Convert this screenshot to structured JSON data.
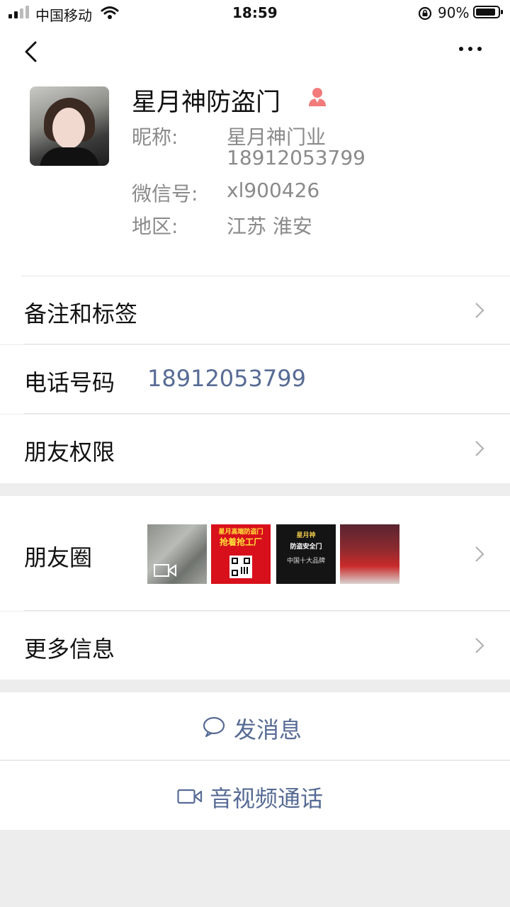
{
  "status_bar": {
    "carrier": "中国移动",
    "time": "18:59",
    "battery": "90%",
    "battery_level": 0.9
  },
  "profile": {
    "name": "星月神防盗门",
    "nickname_label": "昵称:",
    "nickname_line1": "星月神门业",
    "nickname_line2": "18912053799",
    "wechat_label": "微信号:",
    "wechat_id": "xl900426",
    "region_label": "地区:",
    "region": "江苏 淮安"
  },
  "rows": {
    "remarks_tags": "备注和标签",
    "phone_label": "电话号码",
    "phone_value": "18912053799",
    "friend_permissions": "朋友权限",
    "moments": "朋友圈",
    "more_info": "更多信息"
  },
  "moments_thumbs": {
    "t2_top": "星月高端防盗门",
    "t2_main": "抢着抢工厂",
    "t3_brand": "星月神",
    "t3_sub": "防盗安全门",
    "t3_foot": "中国十大品牌"
  },
  "actions": {
    "send_message": "发消息",
    "av_call": "音视频通话"
  },
  "colors": {
    "link": "#576b95",
    "background": "#ededed"
  }
}
